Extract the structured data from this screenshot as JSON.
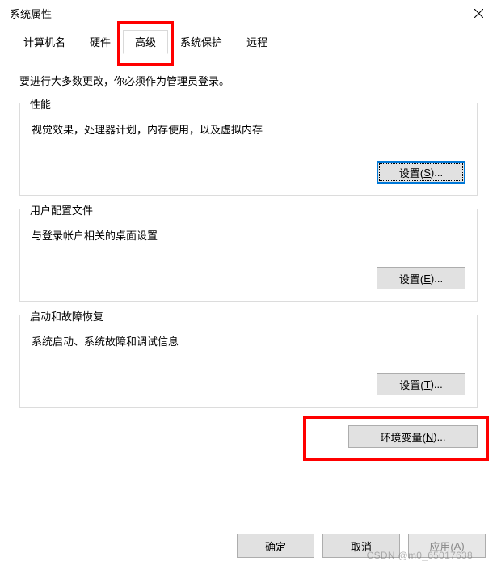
{
  "window": {
    "title": "系统属性"
  },
  "tabs": {
    "t0": "计算机名",
    "t1": "硬件",
    "t2": "高级",
    "t3": "系统保护",
    "t4": "远程"
  },
  "advanced": {
    "intro": "要进行大多数更改，你必须作为管理员登录。",
    "performance": {
      "title": "性能",
      "desc": "视觉效果，处理器计划，内存使用，以及虚拟内存",
      "btn_prefix": "设置(",
      "btn_key": "S",
      "btn_suffix": ")..."
    },
    "profiles": {
      "title": "用户配置文件",
      "desc": "与登录帐户相关的桌面设置",
      "btn_prefix": "设置(",
      "btn_key": "E",
      "btn_suffix": ")..."
    },
    "startup": {
      "title": "启动和故障恢复",
      "desc": "系统启动、系统故障和调试信息",
      "btn_prefix": "设置(",
      "btn_key": "T",
      "btn_suffix": ")..."
    },
    "env_btn_prefix": "环境变量(",
    "env_btn_key": "N",
    "env_btn_suffix": ")..."
  },
  "footer": {
    "ok": "确定",
    "cancel": "取消",
    "apply_prefix": "应用(",
    "apply_key": "A",
    "apply_suffix": ")"
  },
  "watermark": "CSDN @m0_65017638"
}
